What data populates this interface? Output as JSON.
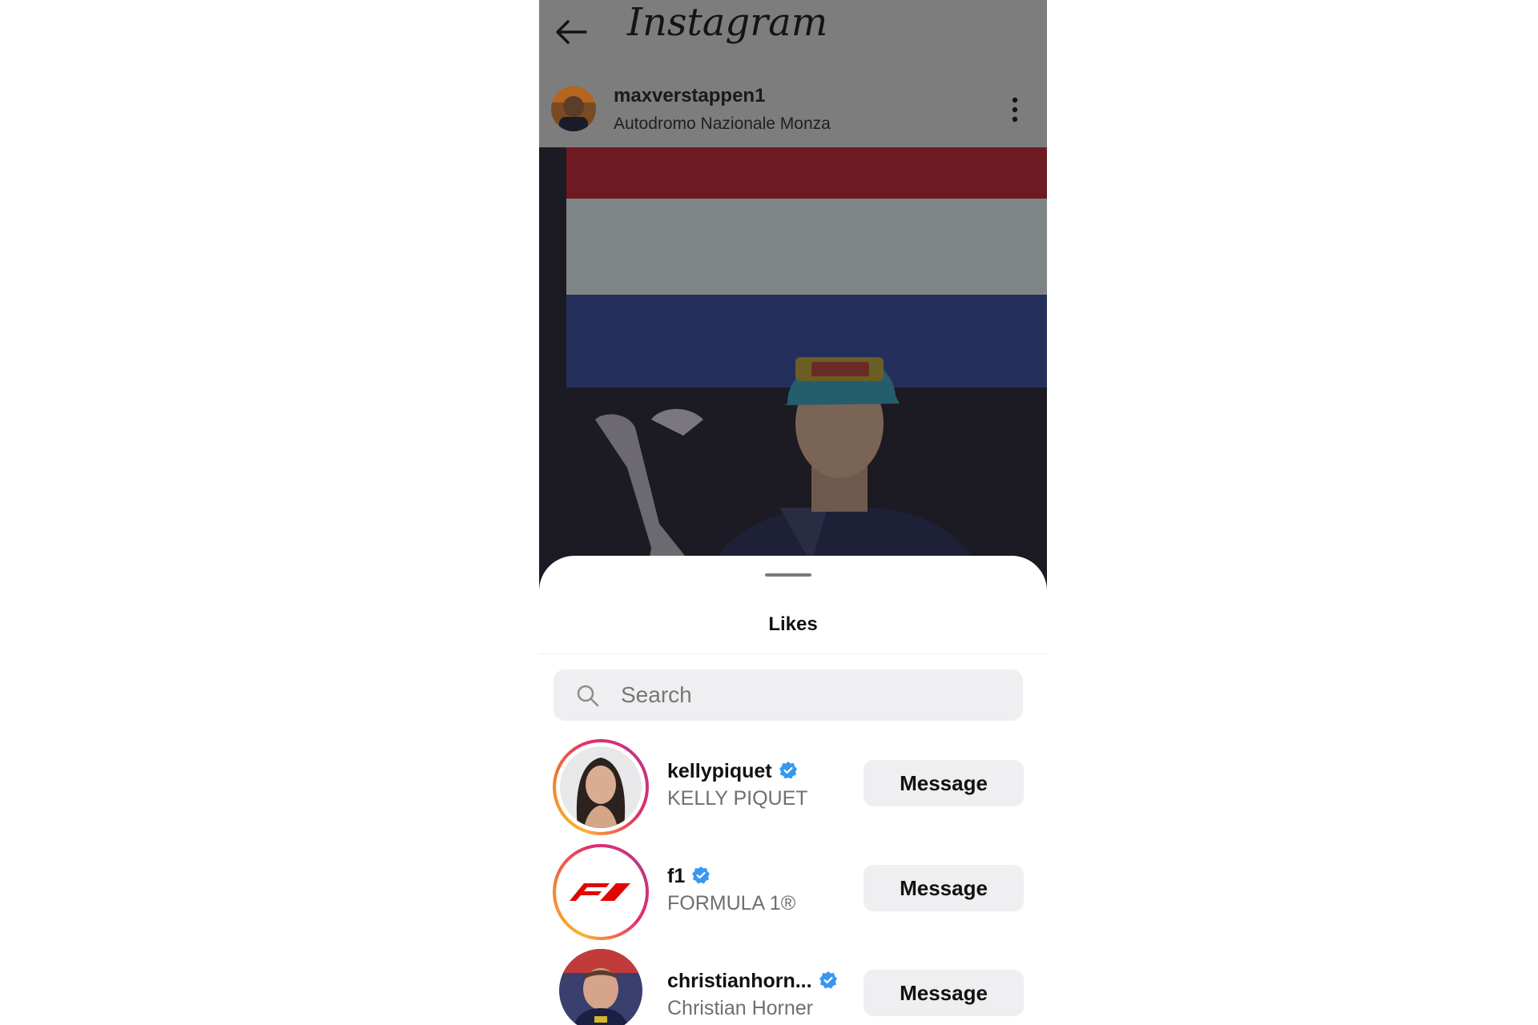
{
  "app": {
    "logo_text": "Instagram"
  },
  "post": {
    "username": "maxverstappen1",
    "location": "Autodromo Nazionale Monza"
  },
  "likes_sheet": {
    "title": "Likes",
    "search_placeholder": "Search",
    "message_label": "Message",
    "users": [
      {
        "username": "kellypiquet",
        "full_name": "KELLY PIQUET",
        "verified": true
      },
      {
        "username": "f1",
        "full_name": "FORMULA 1®",
        "verified": true
      },
      {
        "username": "christianhorn...",
        "full_name": "Christian Horner",
        "verified": true
      }
    ]
  },
  "colors": {
    "overlay_gray": "#7d7d7d",
    "verified_blue": "#3897f0",
    "button_bg": "#efeff1",
    "flag_red": "#ae1c28",
    "flag_white": "#ffffff",
    "flag_blue": "#21468b"
  },
  "icons": [
    "back-arrow-icon",
    "more-options-icon",
    "search-icon",
    "verified-badge-icon"
  ]
}
